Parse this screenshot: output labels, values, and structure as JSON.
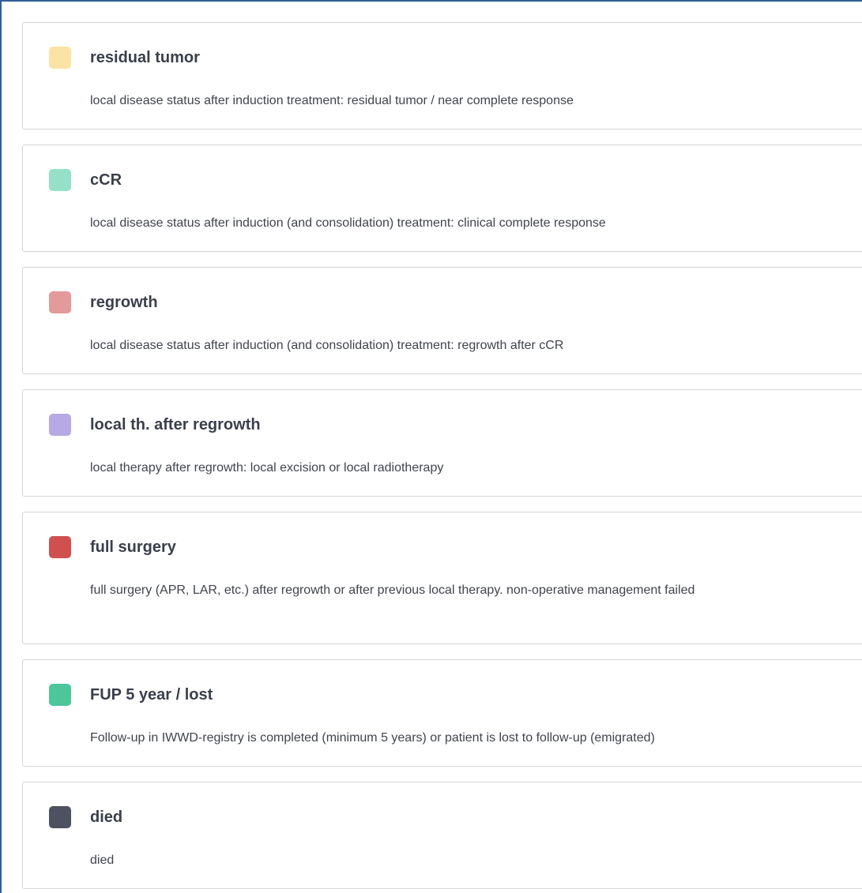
{
  "legend": {
    "items": [
      {
        "title": "residual tumor",
        "description": "local disease status after induction treatment: residual tumor / near complete response",
        "color": "#fbe3a6"
      },
      {
        "title": "cCR",
        "description": "local disease status after induction (and consolidation) treatment: clinical complete response",
        "color": "#96e0c8"
      },
      {
        "title": "regrowth",
        "description": "local disease status after induction (and consolidation) treatment: regrowth after cCR",
        "color": "#e39a9a"
      },
      {
        "title": "local th. after regrowth",
        "description": "local therapy after regrowth: local excision or local radiotherapy",
        "color": "#b7a9e3"
      },
      {
        "title": "full surgery",
        "description": "full surgery (APR, LAR, etc.) after regrowth or after previous local therapy. non-operative management failed",
        "color": "#d05050"
      },
      {
        "title": "FUP 5 year / lost",
        "description": "Follow-up in IWWD-registry is completed (minimum 5 years) or patient is lost to follow-up (emigrated)",
        "color": "#4cc69a"
      },
      {
        "title": "died",
        "description": "died",
        "color": "#4e5160"
      }
    ]
  }
}
